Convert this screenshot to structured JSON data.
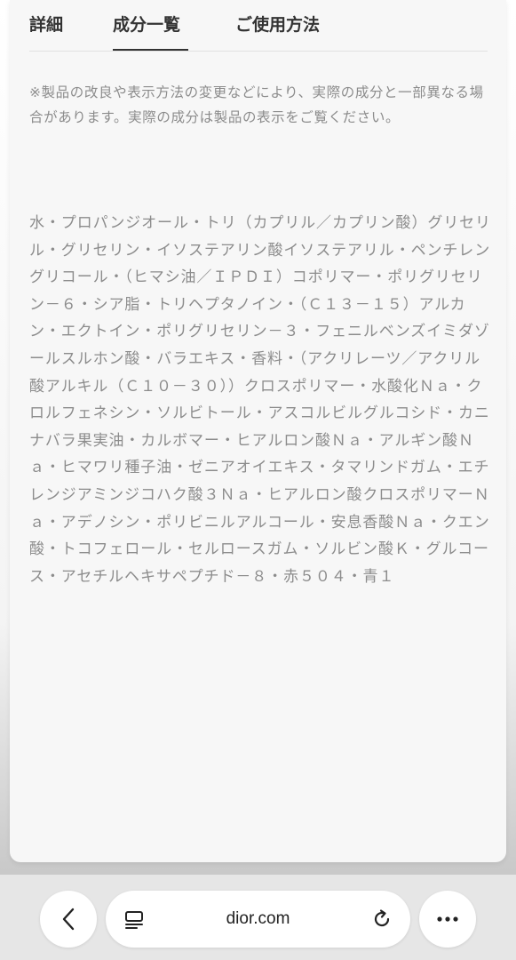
{
  "tabs": {
    "details": "詳細",
    "ingredients": "成分一覧",
    "usage": "ご使用方法",
    "active": "ingredients"
  },
  "notice": "※製品の改良や表示方法の変更などにより、実際の成分と一部異なる場合があります。実際の成分は製品の表示をご覧ください。",
  "ingredients_text": "水・プロパンジオール・トリ（カプリル／カプリン酸）グリセリル・グリセリン・イソステアリン酸イソステアリル・ペンチレングリコール・（ヒマシ油／ＩＰＤＩ）コポリマー・ポリグリセリン－６・シア脂・トリヘプタノイン・（Ｃ１３－１５）アルカン・エクトイン・ポリグリセリン－３・フェニルベンズイミダゾールスルホン酸・バラエキス・香料・（アクリレーツ／アクリル酸アルキル（Ｃ１０－３０））クロスポリマー・水酸化Ｎａ・クロルフェネシン・ソルビトール・アスコルビルグルコシド・カニナバラ果実油・カルボマー・ヒアルロン酸Ｎａ・アルギン酸Ｎａ・ヒマワリ種子油・ゼニアオイエキス・タマリンドガム・エチレンジアミンジコハク酸３Ｎａ・ヒアルロン酸クロスポリマーＮａ・アデノシン・ポリビニルアルコール・安息香酸Ｎａ・クエン酸・トコフェロール・セルロースガム・ソルビン酸Ｋ・グルコース・アセチルヘキサペプチド－８・赤５０４・青１",
  "browser": {
    "url": "dior.com",
    "back_icon": "chevron-left-icon",
    "reader_icon": "reader-mode-icon",
    "reload_icon": "reload-icon",
    "more_icon": "more-dots-icon"
  },
  "colors": {
    "tab_text": "#333333",
    "body_text": "#8c8c8c",
    "sheet_bg": "#f7f7f7"
  }
}
